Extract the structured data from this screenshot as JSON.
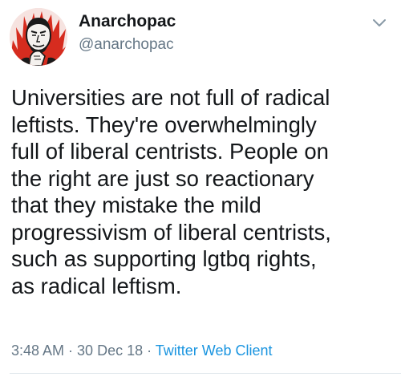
{
  "user": {
    "display_name": "Anarchopac",
    "handle": "@anarchopac",
    "avatar": "illustrated-face-with-red-flames-avatar"
  },
  "tweet": {
    "text": "Universities are not full of radical\nleftists. They're overwhelmingly\nfull of liberal centrists. People on\nthe right are just so reactionary\nthat they mistake the mild\nprogressivism of liberal centrists,\nsuch as supporting lgtbq rights,\nas radical leftism."
  },
  "meta": {
    "time": "3:48 AM",
    "sep1": " · ",
    "date": "30 Dec 18",
    "sep2": " · ",
    "client": "Twitter Web Client"
  },
  "icons": {
    "menu": "chevron-down-icon"
  },
  "colors": {
    "text": "#14171a",
    "secondary": "#657786",
    "link": "#1b95e0",
    "avatar_flames": "#d62c1f"
  }
}
